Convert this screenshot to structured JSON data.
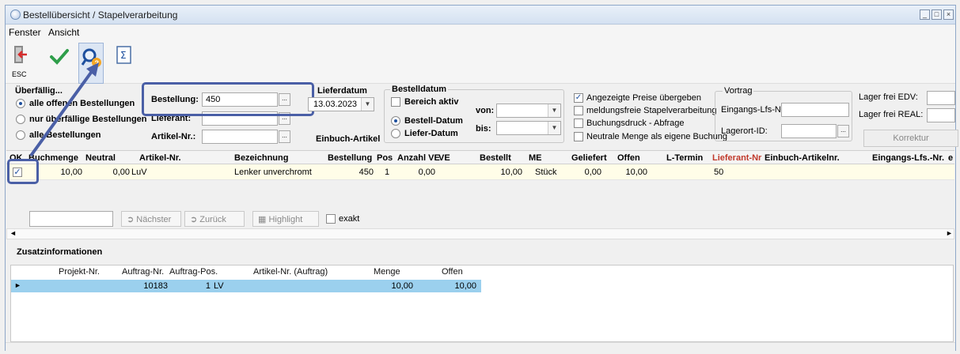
{
  "window": {
    "title": "Bestellübersicht / Stapelverarbeitung",
    "buttons": [
      "_",
      "□",
      "×"
    ]
  },
  "menu": {
    "items": [
      "Fenster",
      "Ansicht"
    ]
  },
  "toolbar": {
    "esc_label": "ESC"
  },
  "filter": {
    "group_label": "Überfällig...",
    "radio_all": "alle offenen Bestellungen",
    "radio_overdue": "nur überfällige Bestellungen",
    "radio_all_orders": "alle Bestellungen",
    "bestellung_label": "Bestellung:",
    "bestellung_value": "450",
    "lieferant_label": "Lieferant:",
    "artikel_label": "Artikel-Nr.:",
    "lieferdatum_label": "Lieferdatum",
    "lieferdatum_value": "13.03.2023",
    "einbuch_label": "Einbuch-Artikel",
    "bestelldatum_label": "Bestelldatum",
    "bereich_aktiv": "Bereich aktiv",
    "bestell_datum": "Bestell-Datum",
    "liefer_datum": "Liefer-Datum",
    "von_label": "von:",
    "bis_label": "bis:",
    "chk_preise": "Angezeigte Preise übergeben",
    "chk_meldungsfrei": "meldungsfreie Stapelverarbeitung",
    "chk_druck": "Buchungsdruck - Abfrage",
    "chk_neutral": "Neutrale Menge als eigene Buchung",
    "vortrag_label": "Vortrag",
    "eingangs_label": "Eingangs-Lfs-Nr.:",
    "lagerort_label": "Lagerort-ID:",
    "lager_edv_label": "Lager frei EDV:",
    "lager_real_label": "Lager frei REAL:",
    "korrektur_label": "Korrektur"
  },
  "grid": {
    "headers": [
      "OK",
      "Buchmenge",
      "Neutral",
      "Artikel-Nr.",
      "Bezeichnung",
      "Bestellung",
      "Pos",
      "Anzahl VE",
      "VE",
      "Bestellt",
      "ME",
      "Geliefert",
      "Offen",
      "L-Termin",
      "Lieferant-Nr",
      "Einbuch-Artikelnr.",
      "Eingangs-Lfs.-Nr.",
      "e"
    ],
    "row": {
      "buchmenge": "10,00",
      "neutral": "0,00",
      "artikel": "LuV",
      "bezeichnung": "Lenker unverchromt",
      "bestellung": "450",
      "pos": "1",
      "anzahl_ve": "0,00",
      "bestellt": "10,00",
      "me": "Stück",
      "geliefert": "0,00",
      "offen": "10,00",
      "lieferant_nr": "50"
    }
  },
  "search": {
    "next": "Nächster",
    "back": "Zurück",
    "highlight": "Highlight",
    "exakt": "exakt"
  },
  "zusatz": {
    "title": "Zusatzinformationen",
    "headers": [
      "Projekt-Nr.",
      "Auftrag-Nr.",
      "Auftrag-Pos.",
      "Artikel-Nr. (Auftrag)",
      "Menge",
      "Offen"
    ],
    "row": {
      "auftrag_nr": "10183",
      "auftrag_pos": "1",
      "artikel": "LV",
      "menge": "10,00",
      "offen": "10,00"
    }
  },
  "colors": {
    "highlight": "#4a5fa6",
    "selected_row": "#9bd0ee",
    "grid_row": "#fffde8",
    "check": "#2e9e4a"
  }
}
